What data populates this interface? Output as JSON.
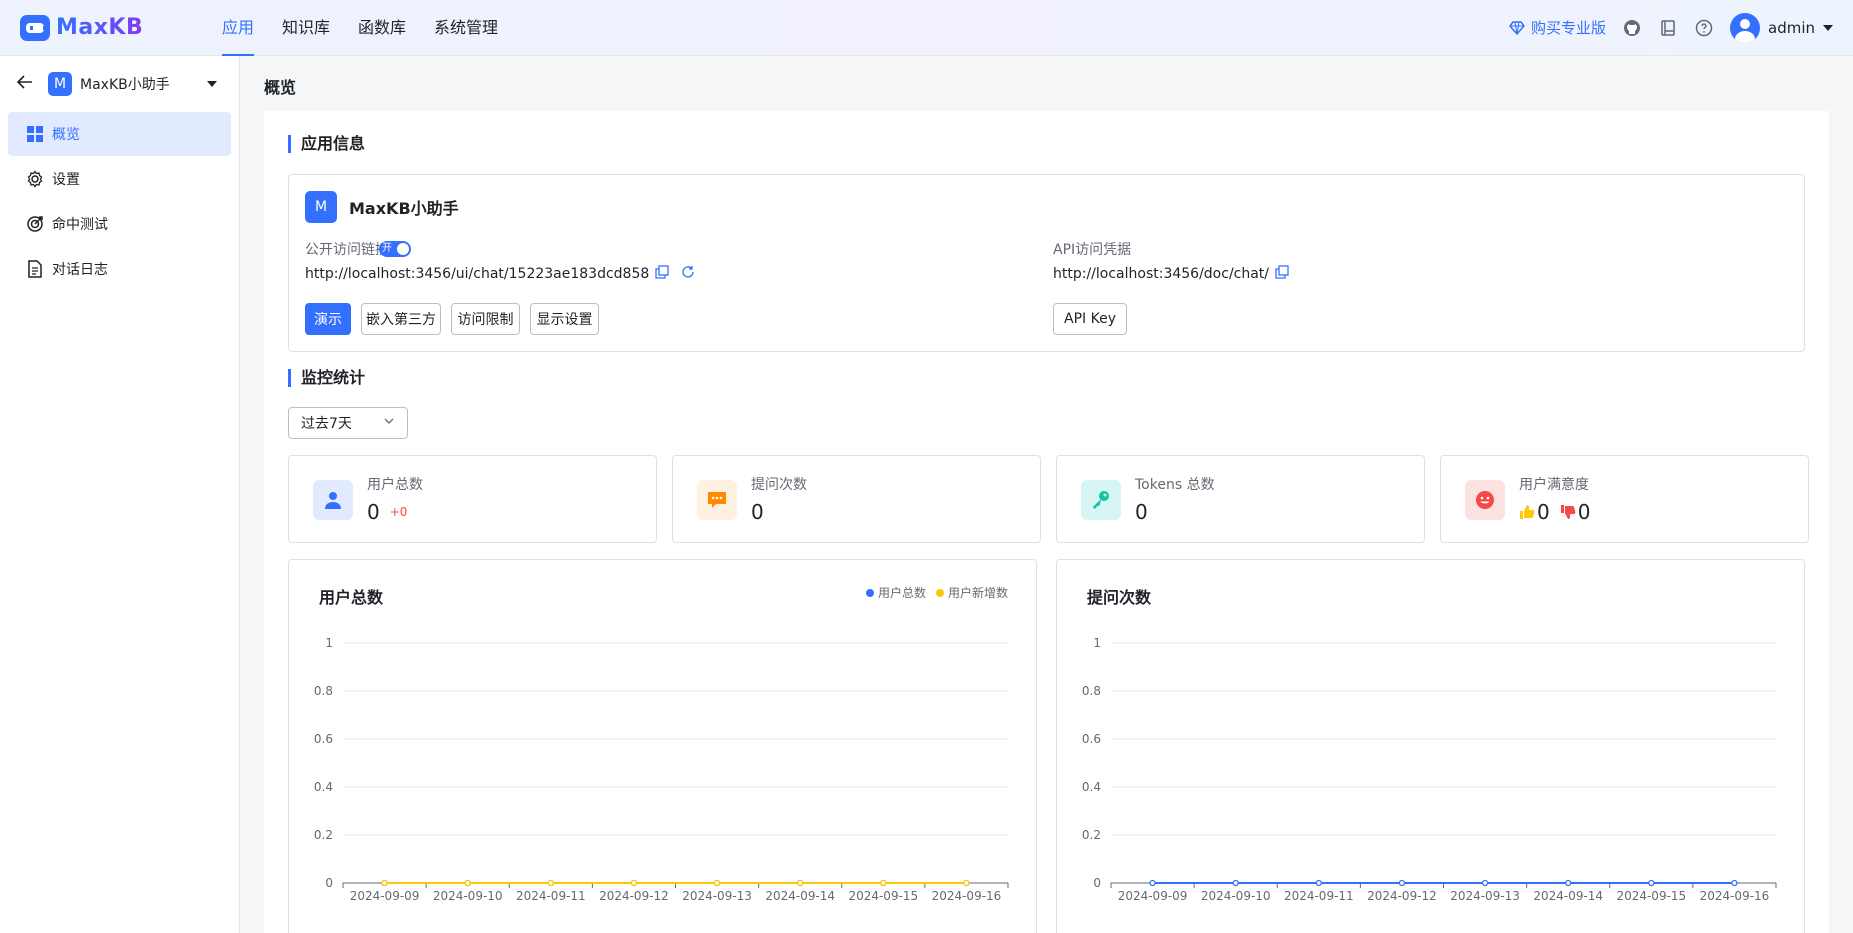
{
  "brand": {
    "name": "MaxKB"
  },
  "nav": {
    "items": [
      "应用",
      "知识库",
      "函数库",
      "系统管理"
    ]
  },
  "top_right": {
    "buy_label": "购买专业版",
    "user_name": "admin"
  },
  "sidebar": {
    "app_badge": "M",
    "app_name": "MaxKB小助手",
    "menu": [
      "概览",
      "设置",
      "命中测试",
      "对话日志"
    ]
  },
  "page": {
    "title": "概览"
  },
  "app_info": {
    "section_title": "应用信息",
    "badge": "M",
    "name": "MaxKB小助手",
    "public_link_label": "公开访问链接",
    "switch_label": "开",
    "public_url": "http://localhost:3456/ui/chat/15223ae183dcd858",
    "api_label": "API访问凭据",
    "api_url": "http://localhost:3456/doc/chat/",
    "buttons": {
      "demo": "演示",
      "embed": "嵌入第三方",
      "access": "访问限制",
      "display": "显示设置",
      "api_key": "API Key"
    }
  },
  "monitor": {
    "section_title": "监控统计",
    "range_value": "过去7天",
    "stats": {
      "users": {
        "label": "用户总数",
        "value": "0",
        "delta": "+0"
      },
      "questions": {
        "label": "提问次数",
        "value": "0"
      },
      "tokens": {
        "label": "Tokens 总数",
        "value": "0"
      },
      "satisfaction": {
        "label": "用户满意度",
        "like": "0",
        "dislike": "0"
      }
    }
  },
  "colors": {
    "accent": "#3370ff",
    "user_series": "#3370ff",
    "new_user_series": "#ffc60a"
  },
  "chart_data": [
    {
      "type": "line",
      "title": "用户总数",
      "x": [
        "2024-09-09",
        "2024-09-10",
        "2024-09-11",
        "2024-09-12",
        "2024-09-13",
        "2024-09-14",
        "2024-09-15",
        "2024-09-16"
      ],
      "series": [
        {
          "name": "用户总数",
          "values": [
            0,
            0,
            0,
            0,
            0,
            0,
            0,
            0
          ],
          "color": "#3370ff"
        },
        {
          "name": "用户新增数",
          "values": [
            0,
            0,
            0,
            0,
            0,
            0,
            0,
            0
          ],
          "color": "#ffc60a"
        }
      ],
      "yticks": [
        "0",
        "0.2",
        "0.4",
        "0.6",
        "0.8",
        "1"
      ],
      "ylim": [
        0,
        1
      ],
      "legend": "top-right",
      "grid": true
    },
    {
      "type": "line",
      "title": "提问次数",
      "x": [
        "2024-09-09",
        "2024-09-10",
        "2024-09-11",
        "2024-09-12",
        "2024-09-13",
        "2024-09-14",
        "2024-09-15",
        "2024-09-16"
      ],
      "series": [
        {
          "values": [
            0,
            0,
            0,
            0,
            0,
            0,
            0,
            0
          ],
          "color": "#3370ff"
        }
      ],
      "yticks": [
        "0",
        "0.2",
        "0.4",
        "0.6",
        "0.8",
        "1"
      ],
      "ylim": [
        0,
        1
      ],
      "grid": true
    }
  ]
}
